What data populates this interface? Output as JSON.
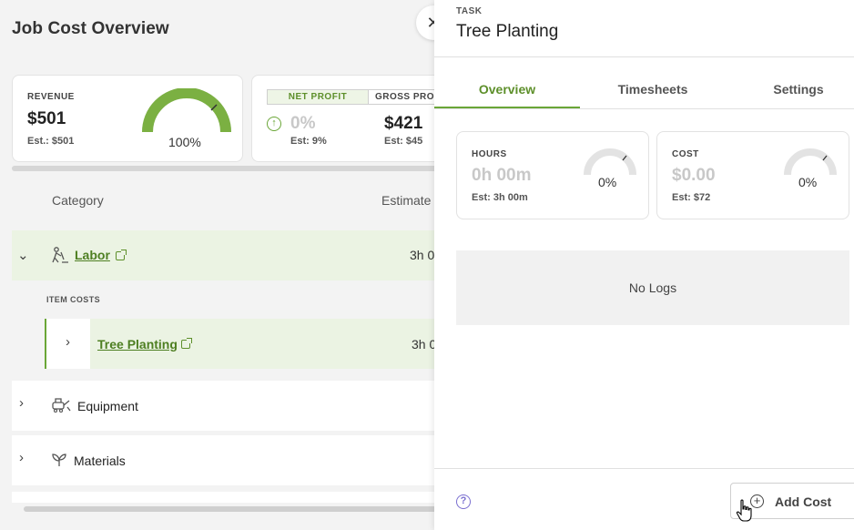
{
  "page": {
    "title": "Job Cost Overview"
  },
  "revenue": {
    "label": "REVENUE",
    "value": "$501",
    "estimate": "Est.:  $501",
    "percent": "100%",
    "gauge_fill": 1.0
  },
  "profit": {
    "tabs": [
      "NET PROFIT",
      "GROSS PRO"
    ],
    "net_value": "0%",
    "net_estimate": "Est: 9%",
    "gross_value": "$421",
    "gross_estimate": "Est: $45"
  },
  "table": {
    "col_category": "Category",
    "col_estimate": "Estimate"
  },
  "rows": {
    "labor": {
      "label": "Labor",
      "estimate": "3h 0"
    },
    "item_costs_label": "ITEM COSTS",
    "tree_planting": {
      "label": "Tree Planting",
      "estimate": "3h 0"
    },
    "equipment": {
      "label": "Equipment"
    },
    "materials": {
      "label": "Materials"
    }
  },
  "drawer": {
    "eyebrow": "TASK",
    "title": "Tree Planting",
    "tabs": [
      "Overview",
      "Timesheets",
      "Settings"
    ],
    "active_tab": "Overview",
    "hours": {
      "label": "HOURS",
      "value": "0h 00m",
      "estimate": "Est: 3h 00m",
      "percent": "0%"
    },
    "cost": {
      "label": "COST",
      "value": "$0.00",
      "estimate": "Est:  $72",
      "percent": "0%"
    },
    "no_logs": "No Logs",
    "add_cost": "Add Cost"
  },
  "colors": {
    "accent_green": "#6aa637",
    "row_highlight": "#ebf3e3",
    "help_purple": "#7a6fd0"
  }
}
